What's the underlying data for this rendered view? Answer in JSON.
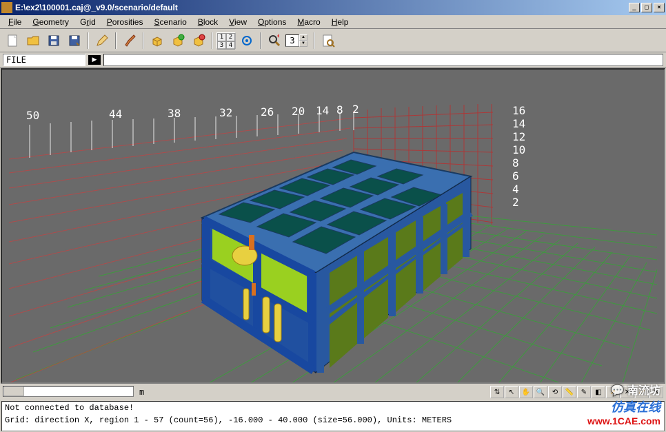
{
  "title": "E:\\ex2\\100001.caj@_v9.0/scenario/default",
  "menu": {
    "file": "File",
    "geometry": "Geometry",
    "grid": "Grid",
    "porosities": "Porosities",
    "scenario": "Scenario",
    "block": "Block",
    "view": "View",
    "options": "Options",
    "macro": "Macro",
    "help": "Help"
  },
  "filebar": {
    "label": "FILE"
  },
  "toolbar": {
    "spinner_value": "3"
  },
  "bottombar": {
    "units": "m"
  },
  "status": {
    "line1": "Not connected to database!",
    "line2": "Grid: direction X, region 1 - 57 (count=56), -16.000 - 40.000 (size=56.000), Units: METERS"
  },
  "axis": {
    "x_labels": [
      "50",
      "44",
      "38",
      "32",
      "26",
      "20",
      "14",
      "8",
      "2"
    ],
    "z_labels": [
      "16",
      "14",
      "12",
      "10",
      "8",
      "6",
      "4",
      "2"
    ]
  },
  "watermark": {
    "l1": "南流坊",
    "l2": "仿真在线",
    "l3": "www.1CAE.com"
  },
  "chart_data": {
    "type": "3d-scene",
    "description": "3D viewport showing a rectangular two-story building frame (blue structural members, green/olive wall panels, yellow cylinders inside) on a green ground grid with red back-wall grid and red floor grid extending outward in perspective.",
    "x_axis": {
      "labels": [
        50,
        44,
        38,
        32,
        26,
        20,
        14,
        8,
        2
      ],
      "direction": "X"
    },
    "z_axis": {
      "labels": [
        2,
        4,
        6,
        8,
        10,
        12,
        14,
        16
      ]
    },
    "grid_info": {
      "direction": "X",
      "region": [
        1,
        57
      ],
      "count": 56,
      "range": [
        -16.0,
        40.0
      ],
      "size": 56.0,
      "units": "METERS"
    }
  }
}
